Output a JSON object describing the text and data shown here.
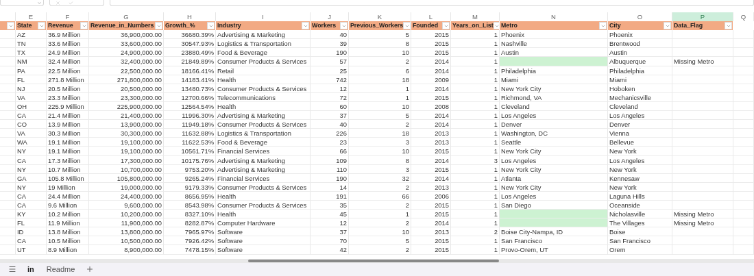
{
  "columns": [
    {
      "letter": "E",
      "name": "State",
      "kind": "text",
      "selected": false
    },
    {
      "letter": "F",
      "name": "Revenue",
      "kind": "text",
      "selected": false
    },
    {
      "letter": "G",
      "name": "Revenue_in_Numbers",
      "kind": "number",
      "selected": false
    },
    {
      "letter": "H",
      "name": "Growth_%",
      "kind": "number",
      "selected": false
    },
    {
      "letter": "I",
      "name": "Industry",
      "kind": "text",
      "selected": false
    },
    {
      "letter": "J",
      "name": "Workers",
      "kind": "number",
      "selected": false
    },
    {
      "letter": "K",
      "name": "Previous_Workers",
      "kind": "number",
      "selected": false
    },
    {
      "letter": "L",
      "name": "Founded",
      "kind": "number",
      "selected": false
    },
    {
      "letter": "M",
      "name": "Years_on_List",
      "kind": "number",
      "selected": false
    },
    {
      "letter": "N",
      "name": "Metro",
      "kind": "text",
      "selected": false
    },
    {
      "letter": "O",
      "name": "City",
      "kind": "text",
      "selected": false
    },
    {
      "letter": "P",
      "name": "Data_Flag",
      "kind": "text",
      "selected": true
    },
    {
      "letter": "Q",
      "kind": "blank",
      "selected": false
    }
  ],
  "rows": [
    {
      "flagged": false,
      "cells": [
        "AZ",
        "36.9 Million",
        "36,900,000.00",
        "36680.39%",
        "Advertising & Marketing",
        "40",
        "5",
        "2015",
        "1",
        "Phoenix",
        "Phoenix",
        null
      ]
    },
    {
      "flagged": false,
      "cells": [
        "TN",
        "33.6 Million",
        "33,600,000.00",
        "30547.93%",
        "Logistics & Transportation",
        "39",
        "8",
        "2015",
        "1",
        "Nashville",
        "Brentwood",
        null
      ]
    },
    {
      "flagged": false,
      "cells": [
        "TX",
        "24.9 Million",
        "24,900,000.00",
        "23880.49%",
        "Food & Beverage",
        "190",
        "10",
        "2015",
        "1",
        "Austin",
        "Austin",
        null
      ]
    },
    {
      "flagged": true,
      "cells": [
        "NM",
        "32.4 Million",
        "32,400,000.00",
        "21849.89%",
        "Consumer Products & Services",
        "57",
        "2",
        "2014",
        "1",
        null,
        "Albuquerque",
        "Missing Metro"
      ]
    },
    {
      "flagged": false,
      "cells": [
        "PA",
        "22.5 Million",
        "22,500,000.00",
        "18166.41%",
        "Retail",
        "25",
        "6",
        "2014",
        "1",
        "Philadelphia",
        "Philadelphia",
        null
      ]
    },
    {
      "flagged": false,
      "cells": [
        "FL",
        "271.8 Million",
        "271,800,000.00",
        "14183.41%",
        "Health",
        "742",
        "18",
        "2009",
        "1",
        "Miami",
        "Miami",
        null
      ]
    },
    {
      "flagged": false,
      "cells": [
        "NJ",
        "20.5 Million",
        "20,500,000.00",
        "13480.73%",
        "Consumer Products & Services",
        "12",
        "1",
        "2014",
        "1",
        "New York City",
        "Hoboken",
        null
      ]
    },
    {
      "flagged": false,
      "cells": [
        "VA",
        "23.3 Million",
        "23,300,000.00",
        "12700.66%",
        "Telecommunications",
        "72",
        "1",
        "2015",
        "1",
        "Richmond, VA",
        "Mechanicsville",
        null
      ]
    },
    {
      "flagged": false,
      "cells": [
        "OH",
        "225.9 Million",
        "225,900,000.00",
        "12564.54%",
        "Health",
        "60",
        "10",
        "2008",
        "1",
        "Cleveland",
        "Cleveland",
        null
      ]
    },
    {
      "flagged": false,
      "cells": [
        "CA",
        "21.4 Million",
        "21,400,000.00",
        "11996.30%",
        "Advertising & Marketing",
        "37",
        "5",
        "2014",
        "1",
        "Los Angeles",
        "Los Angeles",
        null
      ]
    },
    {
      "flagged": false,
      "cells": [
        "CO",
        "13.9 Million",
        "13,900,000.00",
        "11949.18%",
        "Consumer Products & Services",
        "40",
        "2",
        "2014",
        "1",
        "Denver",
        "Denver",
        null
      ]
    },
    {
      "flagged": false,
      "cells": [
        "VA",
        "30.3 Million",
        "30,300,000.00",
        "11632.88%",
        "Logistics & Transportation",
        "226",
        "18",
        "2013",
        "1",
        "Washington, DC",
        "Vienna",
        null
      ]
    },
    {
      "flagged": false,
      "cells": [
        "WA",
        "19.1 Million",
        "19,100,000.00",
        "11622.53%",
        "Food & Beverage",
        "23",
        "3",
        "2013",
        "1",
        "Seattle",
        "Bellevue",
        null
      ]
    },
    {
      "flagged": false,
      "cells": [
        "NY",
        "19.1 Million",
        "19,100,000.00",
        "10561.71%",
        "Financial Services",
        "66",
        "10",
        "2015",
        "1",
        "New York City",
        "New York",
        null
      ]
    },
    {
      "flagged": false,
      "cells": [
        "CA",
        "17.3 Million",
        "17,300,000.00",
        "10175.76%",
        "Advertising & Marketing",
        "109",
        "8",
        "2014",
        "3",
        "Los Angeles",
        "Los Angeles",
        null
      ]
    },
    {
      "flagged": false,
      "cells": [
        "NY",
        "10.7 Million",
        "10,700,000.00",
        "9753.20%",
        "Advertising & Marketing",
        "110",
        "3",
        "2015",
        "1",
        "New York City",
        "New York",
        null
      ]
    },
    {
      "flagged": false,
      "cells": [
        "GA",
        "105.8 Million",
        "105,800,000.00",
        "9265.24%",
        "Financial Services",
        "190",
        "32",
        "2014",
        "1",
        "Atlanta",
        "Kennesaw",
        null
      ]
    },
    {
      "flagged": false,
      "cells": [
        "NY",
        "19 Million",
        "19,000,000.00",
        "9179.33%",
        "Consumer Products & Services",
        "14",
        "2",
        "2013",
        "1",
        "New York City",
        "New York",
        null
      ]
    },
    {
      "flagged": false,
      "cells": [
        "CA",
        "24.4 Million",
        "24,400,000.00",
        "8656.95%",
        "Health",
        "191",
        "66",
        "2006",
        "1",
        "Los Angeles",
        "Laguna Hills",
        null
      ]
    },
    {
      "flagged": false,
      "cells": [
        "CA",
        "9.6 Million",
        "9,600,000.00",
        "8543.98%",
        "Consumer Products & Services",
        "35",
        "2",
        "2015",
        "1",
        "San Diego",
        "Oceanside",
        null
      ]
    },
    {
      "flagged": true,
      "cells": [
        "KY",
        "10.2 Million",
        "10,200,000.00",
        "8327.10%",
        "Health",
        "45",
        "1",
        "2015",
        "1",
        null,
        "Nicholasville",
        "Missing Metro"
      ]
    },
    {
      "flagged": true,
      "cells": [
        "FL",
        "11.9 Million",
        "11,900,000.00",
        "8282.87%",
        "Computer Hardware",
        "12",
        "2",
        "2014",
        "1",
        null,
        "The Villages",
        "Missing Metro"
      ]
    },
    {
      "flagged": false,
      "cells": [
        "ID",
        "13.8 Million",
        "13,800,000.00",
        "7965.97%",
        "Software",
        "37",
        "10",
        "2013",
        "2",
        "Boise City-Nampa, ID",
        "Boise",
        null
      ]
    },
    {
      "flagged": false,
      "cells": [
        "CA",
        "10.5 Million",
        "10,500,000.00",
        "7926.42%",
        "Software",
        "70",
        "5",
        "2015",
        "1",
        "San Francisco",
        "San Francisco",
        null
      ]
    },
    {
      "flagged": false,
      "cells": [
        "UT",
        "8.9 Million",
        "8,900,000.00",
        "7478.15%",
        "Software",
        "42",
        "2",
        "2015",
        "1",
        "Provo-Orem, UT",
        "Orem",
        null
      ]
    }
  ],
  "sheet_tabs": [
    {
      "label": "in",
      "selected": true
    },
    {
      "label": "Readme",
      "selected": false
    }
  ]
}
